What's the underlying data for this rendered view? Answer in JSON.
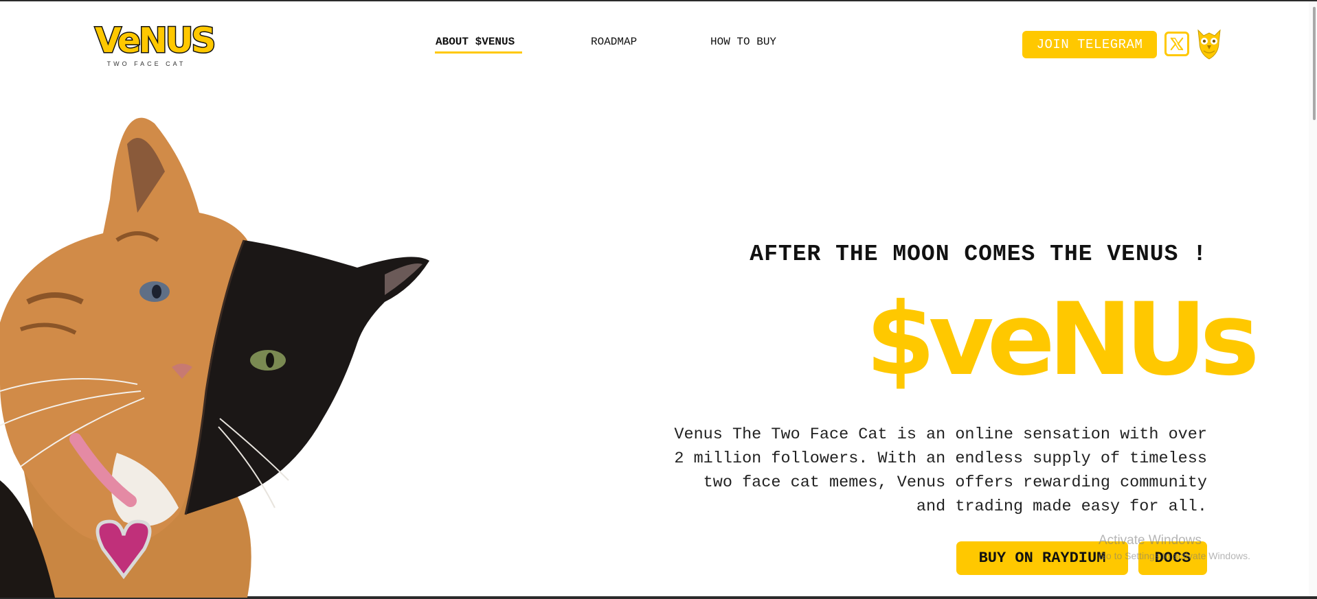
{
  "brand": {
    "logo_text": "VeNUS",
    "logo_subtitle": "TWO FACE CAT",
    "accent_color": "#ffc800"
  },
  "nav": {
    "items": [
      {
        "label": "ABOUT $VENUS",
        "active": true
      },
      {
        "label": "ROADMAP",
        "active": false
      },
      {
        "label": "HOW TO BUY",
        "active": false
      }
    ]
  },
  "header_actions": {
    "telegram_label": "JOIN TELEGRAM",
    "x_icon": "x-twitter-icon",
    "owl_icon": "owl-icon"
  },
  "hero": {
    "tagline": "AFTER THE MOON COMES THE VENUS !",
    "title": "$veNUs",
    "description_lines": [
      "Venus The Two Face Cat is an online sensation with over",
      "2 million followers. With an endless supply of timeless",
      "two face cat memes, Venus offers rewarding community",
      "and trading made easy for all."
    ],
    "image": "two-face-cat-image",
    "buttons": {
      "buy": "BUY ON RAYDIUM",
      "docs": "DOCS"
    }
  },
  "os_watermark": {
    "title": "Activate Windows",
    "subtitle": "Go to Settings to activate Windows."
  }
}
